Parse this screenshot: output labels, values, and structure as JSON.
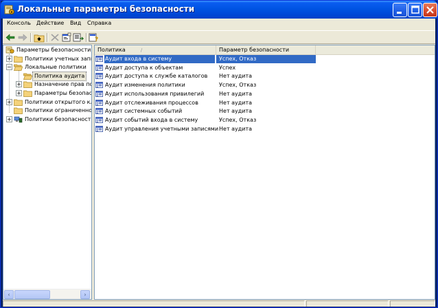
{
  "window": {
    "title": "Локальные параметры безопасности",
    "min_icon": "minimize-icon",
    "max_icon": "maximize-icon",
    "close_icon": "close-icon"
  },
  "menu": {
    "items": [
      "Консоль",
      "Действие",
      "Вид",
      "Справка"
    ]
  },
  "toolbar": {
    "icons": [
      "back-arrow-icon",
      "forward-arrow-icon",
      "up-folder-icon",
      "delete-icon",
      "properties-icon",
      "export-list-icon",
      "help-icon"
    ]
  },
  "tree": {
    "items": [
      {
        "label": "Параметры безопасности",
        "icon": "security-settings-icon",
        "level": 0,
        "expander": ""
      },
      {
        "label": "Политики учетных запис",
        "icon": "folder-icon",
        "level": 1,
        "expander": "+"
      },
      {
        "label": "Локальные политики",
        "icon": "folder-open-icon",
        "level": 1,
        "expander": "−"
      },
      {
        "label": "Политика аудита",
        "icon": "folder-open-icon",
        "level": 2,
        "expander": ""
      },
      {
        "label": "Назначение прав поли",
        "icon": "folder-icon",
        "level": 2,
        "expander": "+"
      },
      {
        "label": "Параметры безопаснос",
        "icon": "folder-icon",
        "level": 2,
        "expander": "+"
      },
      {
        "label": "Политики открытого клю",
        "icon": "folder-icon",
        "level": 1,
        "expander": "+"
      },
      {
        "label": "Политики ограниченного",
        "icon": "folder-icon",
        "level": 1,
        "expander": ""
      },
      {
        "label": "Политики безопасности I",
        "icon": "ip-security-icon",
        "level": 1,
        "expander": "+"
      }
    ]
  },
  "list": {
    "columns": [
      "Политика",
      "Параметр безопасности"
    ],
    "sort_indicator": "/",
    "rows": [
      {
        "name": "Аудит входа в систему",
        "value": "Успех, Отказ"
      },
      {
        "name": "Аудит доступа к объектам",
        "value": "Успех"
      },
      {
        "name": "Аудит доступа к службе каталогов",
        "value": "Нет аудита"
      },
      {
        "name": "Аудит изменения политики",
        "value": "Успех, Отказ"
      },
      {
        "name": "Аудит использования привилегий",
        "value": "Нет аудита"
      },
      {
        "name": "Аудит отслеживания процессов",
        "value": "Нет аудита"
      },
      {
        "name": "Аудит системных событий",
        "value": "Нет аудита"
      },
      {
        "name": "Аудит событий входа в систему",
        "value": "Успех, Отказ"
      },
      {
        "name": "Аудит управления учетными записями",
        "value": "Нет аудита"
      }
    ]
  },
  "colors": {
    "titlebar": "#0054e3",
    "selection": "#316ac5",
    "folder": "#f4d27a"
  }
}
